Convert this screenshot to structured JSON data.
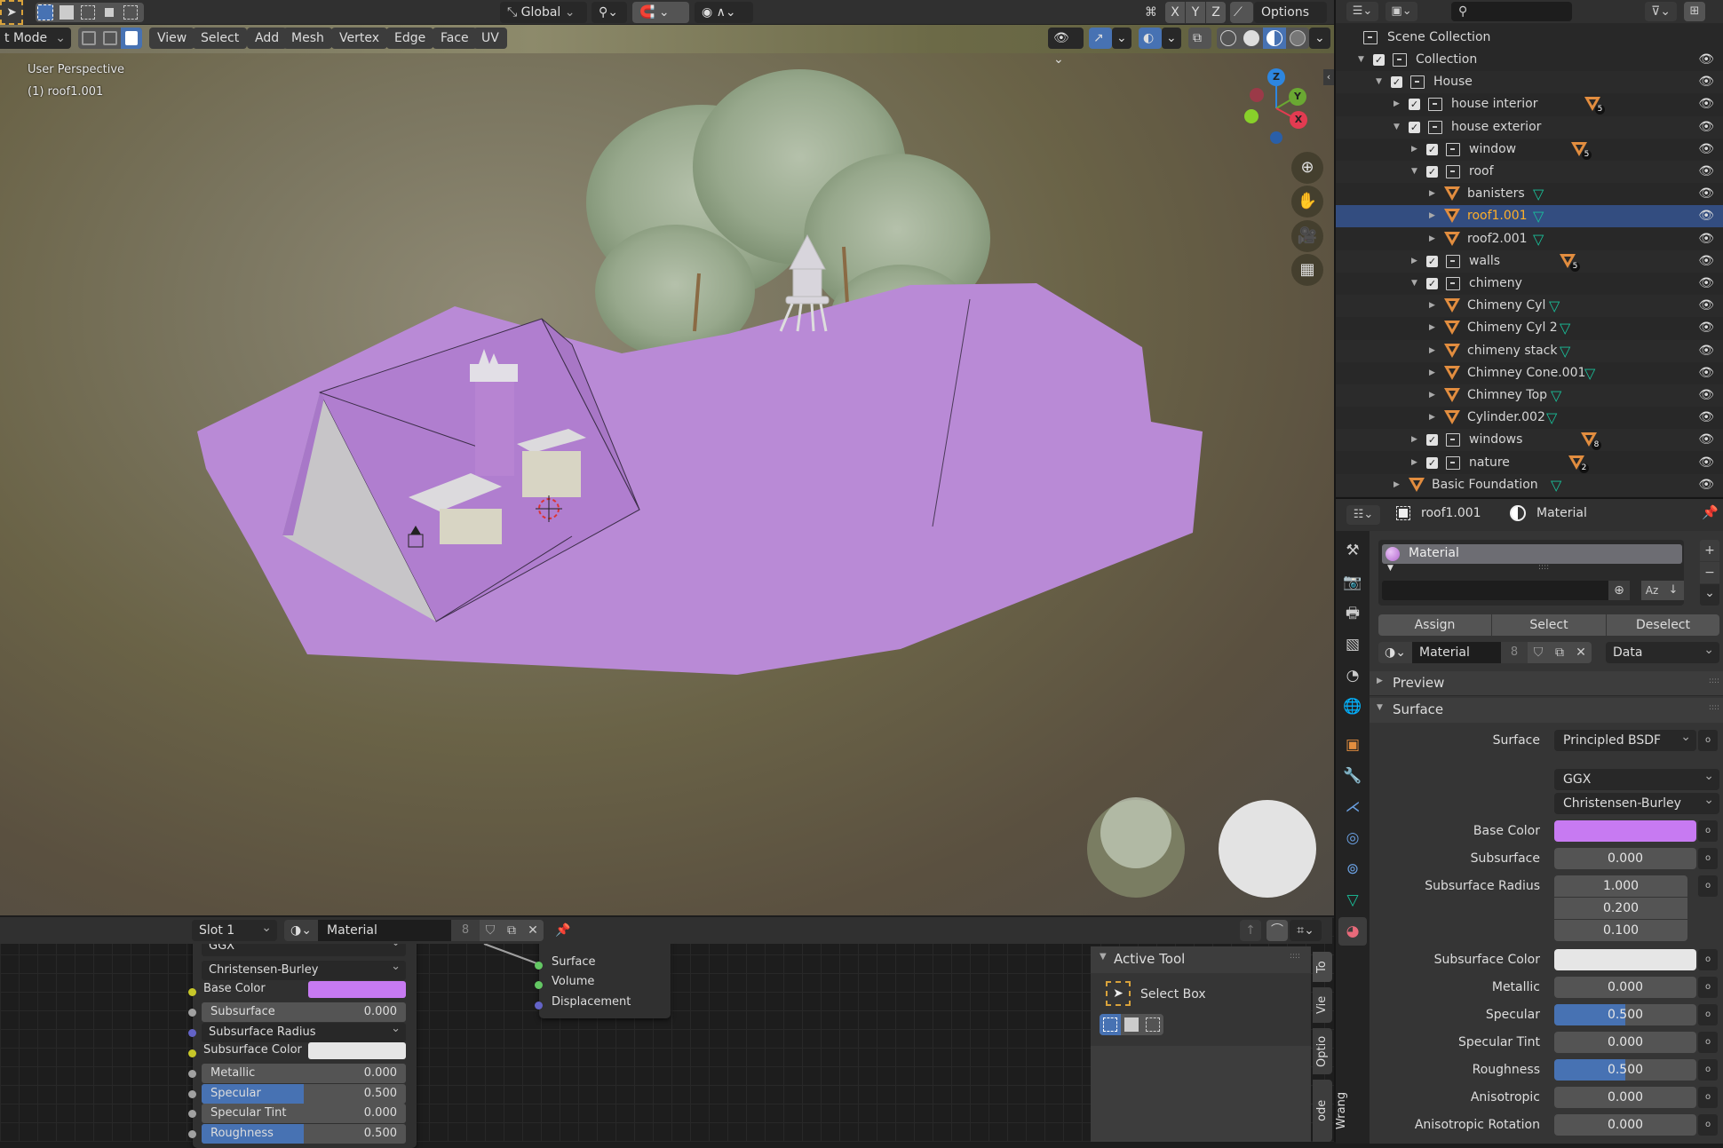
{
  "topbar": {
    "transform_orientation": "Global",
    "axes": [
      "X",
      "Y",
      "Z"
    ],
    "options_label": "Options"
  },
  "viewport": {
    "mode_label": "t Mode",
    "menus": [
      "View",
      "Select",
      "Add",
      "Mesh",
      "Vertex",
      "Edge",
      "Face",
      "UV"
    ],
    "overlay_line1": "User Perspective",
    "overlay_line2": "(1) roof1.001",
    "gizmo_axes": {
      "z": "Z",
      "y": "Y",
      "x": "X"
    },
    "colors": {
      "plane": "#b98ad6",
      "roof": "#b07ecf",
      "z_axis": "#2d86e0",
      "y_axis": "#6aa832",
      "x_axis": "#e33b51"
    }
  },
  "outliner": {
    "search_placeholder": "",
    "scene_collection": "Scene Collection",
    "rows": [
      {
        "label": "Collection",
        "type": "collection",
        "depth": 0,
        "expanded": true,
        "checkbox": true
      },
      {
        "label": "House",
        "type": "collection",
        "depth": 1,
        "expanded": true,
        "checkbox": true
      },
      {
        "label": "house interior",
        "type": "collection",
        "depth": 2,
        "expanded": false,
        "checkbox": true,
        "badge": "5"
      },
      {
        "label": "house exterior",
        "type": "collection",
        "depth": 2,
        "expanded": true,
        "checkbox": true
      },
      {
        "label": "window",
        "type": "collection",
        "depth": 3,
        "expanded": false,
        "checkbox": true,
        "badge": "5"
      },
      {
        "label": "roof",
        "type": "collection",
        "depth": 3,
        "expanded": true,
        "checkbox": true
      },
      {
        "label": "banisters",
        "type": "object",
        "depth": 4,
        "mesh": true
      },
      {
        "label": "roof1.001",
        "type": "object",
        "depth": 4,
        "mesh": true,
        "selected": true
      },
      {
        "label": "roof2.001",
        "type": "object",
        "depth": 4,
        "mesh": true
      },
      {
        "label": "walls",
        "type": "collection",
        "depth": 3,
        "expanded": false,
        "checkbox": true,
        "badge": "5"
      },
      {
        "label": "chimeny",
        "type": "collection",
        "depth": 3,
        "expanded": true,
        "checkbox": true
      },
      {
        "label": "Chimeny Cyl",
        "type": "object",
        "depth": 4,
        "mesh": true
      },
      {
        "label": "Chimeny Cyl 2",
        "type": "object",
        "depth": 4,
        "mesh": true
      },
      {
        "label": "chimeny stack",
        "type": "object",
        "depth": 4,
        "mesh": true
      },
      {
        "label": "Chimney Cone.001",
        "type": "object",
        "depth": 4,
        "mesh": true
      },
      {
        "label": "Chimney Top",
        "type": "object",
        "depth": 4,
        "mesh": true
      },
      {
        "label": "Cylinder.002",
        "type": "object",
        "depth": 4,
        "mesh": true
      },
      {
        "label": "windows",
        "type": "collection",
        "depth": 3,
        "expanded": false,
        "checkbox": true,
        "badge": "8"
      },
      {
        "label": "nature",
        "type": "collection",
        "depth": 3,
        "expanded": false,
        "checkbox": true,
        "badge": "2"
      },
      {
        "label": "Basic Foundation",
        "type": "object",
        "depth": 2,
        "mesh": true
      }
    ]
  },
  "properties": {
    "object_name": "roof1.001",
    "context": "Material",
    "slot_material": "Material",
    "assign": "Assign",
    "select": "Select",
    "deselect": "Deselect",
    "material_name": "Material",
    "users": "8",
    "link": "Data",
    "preview": "Preview",
    "surface_panel": "Surface",
    "surface_label": "Surface",
    "surface_value": "Principled BSDF",
    "distribution": "GGX",
    "subsurface_method": "Christensen-Burley",
    "base_color_label": "Base Color",
    "base_color": "#c77af2",
    "subsurface_label": "Subsurface",
    "subsurface": "0.000",
    "subsurface_radius_label": "Subsurface Radius",
    "subsurface_radius": [
      "1.000",
      "0.200",
      "0.100"
    ],
    "subsurface_color_label": "Subsurface Color",
    "subsurface_color": "#e6e6e6",
    "metallic_label": "Metallic",
    "metallic": "0.000",
    "specular_label": "Specular",
    "specular": "0.500",
    "specular_fraction": 0.5,
    "specular_tint_label": "Specular Tint",
    "specular_tint": "0.000",
    "roughness_label": "Roughness",
    "roughness": "0.500",
    "roughness_fraction": 0.5,
    "anisotropic_label": "Anisotropic",
    "anisotropic": "0.000",
    "anisotropic_rotation_label": "Anisotropic Rotation",
    "anisotropic_rotation": "0.000"
  },
  "node_editor": {
    "slot": "Slot 1",
    "material": "Material",
    "users": "8",
    "distribution": "GGX",
    "subsurface_method": "Christensen-Burley",
    "inputs": {
      "base_color": "Base Color",
      "subsurface": "Subsurface",
      "subsurface_val": "0.000",
      "subsurface_radius": "Subsurface Radius",
      "subsurface_color": "Subsurface Color",
      "metallic": "Metallic",
      "metallic_val": "0.000",
      "specular": "Specular",
      "specular_val": "0.500",
      "specular_tint": "Specular Tint",
      "specular_tint_val": "0.000",
      "roughness": "Roughness",
      "roughness_val": "0.500"
    },
    "output_sockets": [
      "Surface",
      "Volume",
      "Displacement"
    ],
    "active_tool_panel": "Active Tool",
    "active_tool": "Select Box",
    "side_tabs": [
      "To",
      "Vie",
      "Optio",
      "ode Wrang"
    ]
  }
}
